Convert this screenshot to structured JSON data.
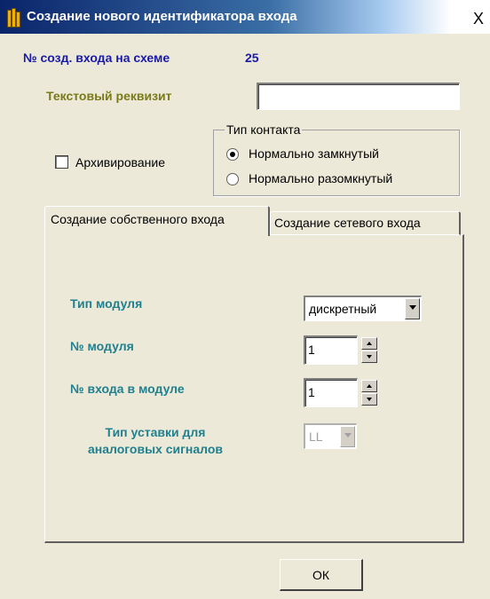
{
  "window": {
    "title": "Создание нового идентификатора входа",
    "close_label": "X"
  },
  "header": {
    "input_num_label": "№ созд. входа на схеме",
    "input_num_value": "25"
  },
  "text_attr": {
    "label": "Текстовый реквизит",
    "value": ""
  },
  "archive": {
    "label": "Архивирование",
    "checked": false
  },
  "contact_type": {
    "legend": "Тип контакта",
    "options": [
      {
        "label": "Нормально замкнутый",
        "selected": true
      },
      {
        "label": "Нормально разомкнутый",
        "selected": false
      }
    ]
  },
  "tabs": [
    {
      "label": "Создание собственного входа",
      "active": true
    },
    {
      "label": "Создание  сетевого входа",
      "active": false
    }
  ],
  "module": {
    "type_label": "Тип модуля",
    "type_value": "дискретный",
    "num_label": "№ модуля",
    "num_value": "1",
    "input_label": "№ входа в модуле",
    "input_value": "1",
    "setpoint_label_line1": "Тип уставки  для",
    "setpoint_label_line2": "аналоговых сигналов",
    "setpoint_value": "LL"
  },
  "ok_label": "ОК"
}
